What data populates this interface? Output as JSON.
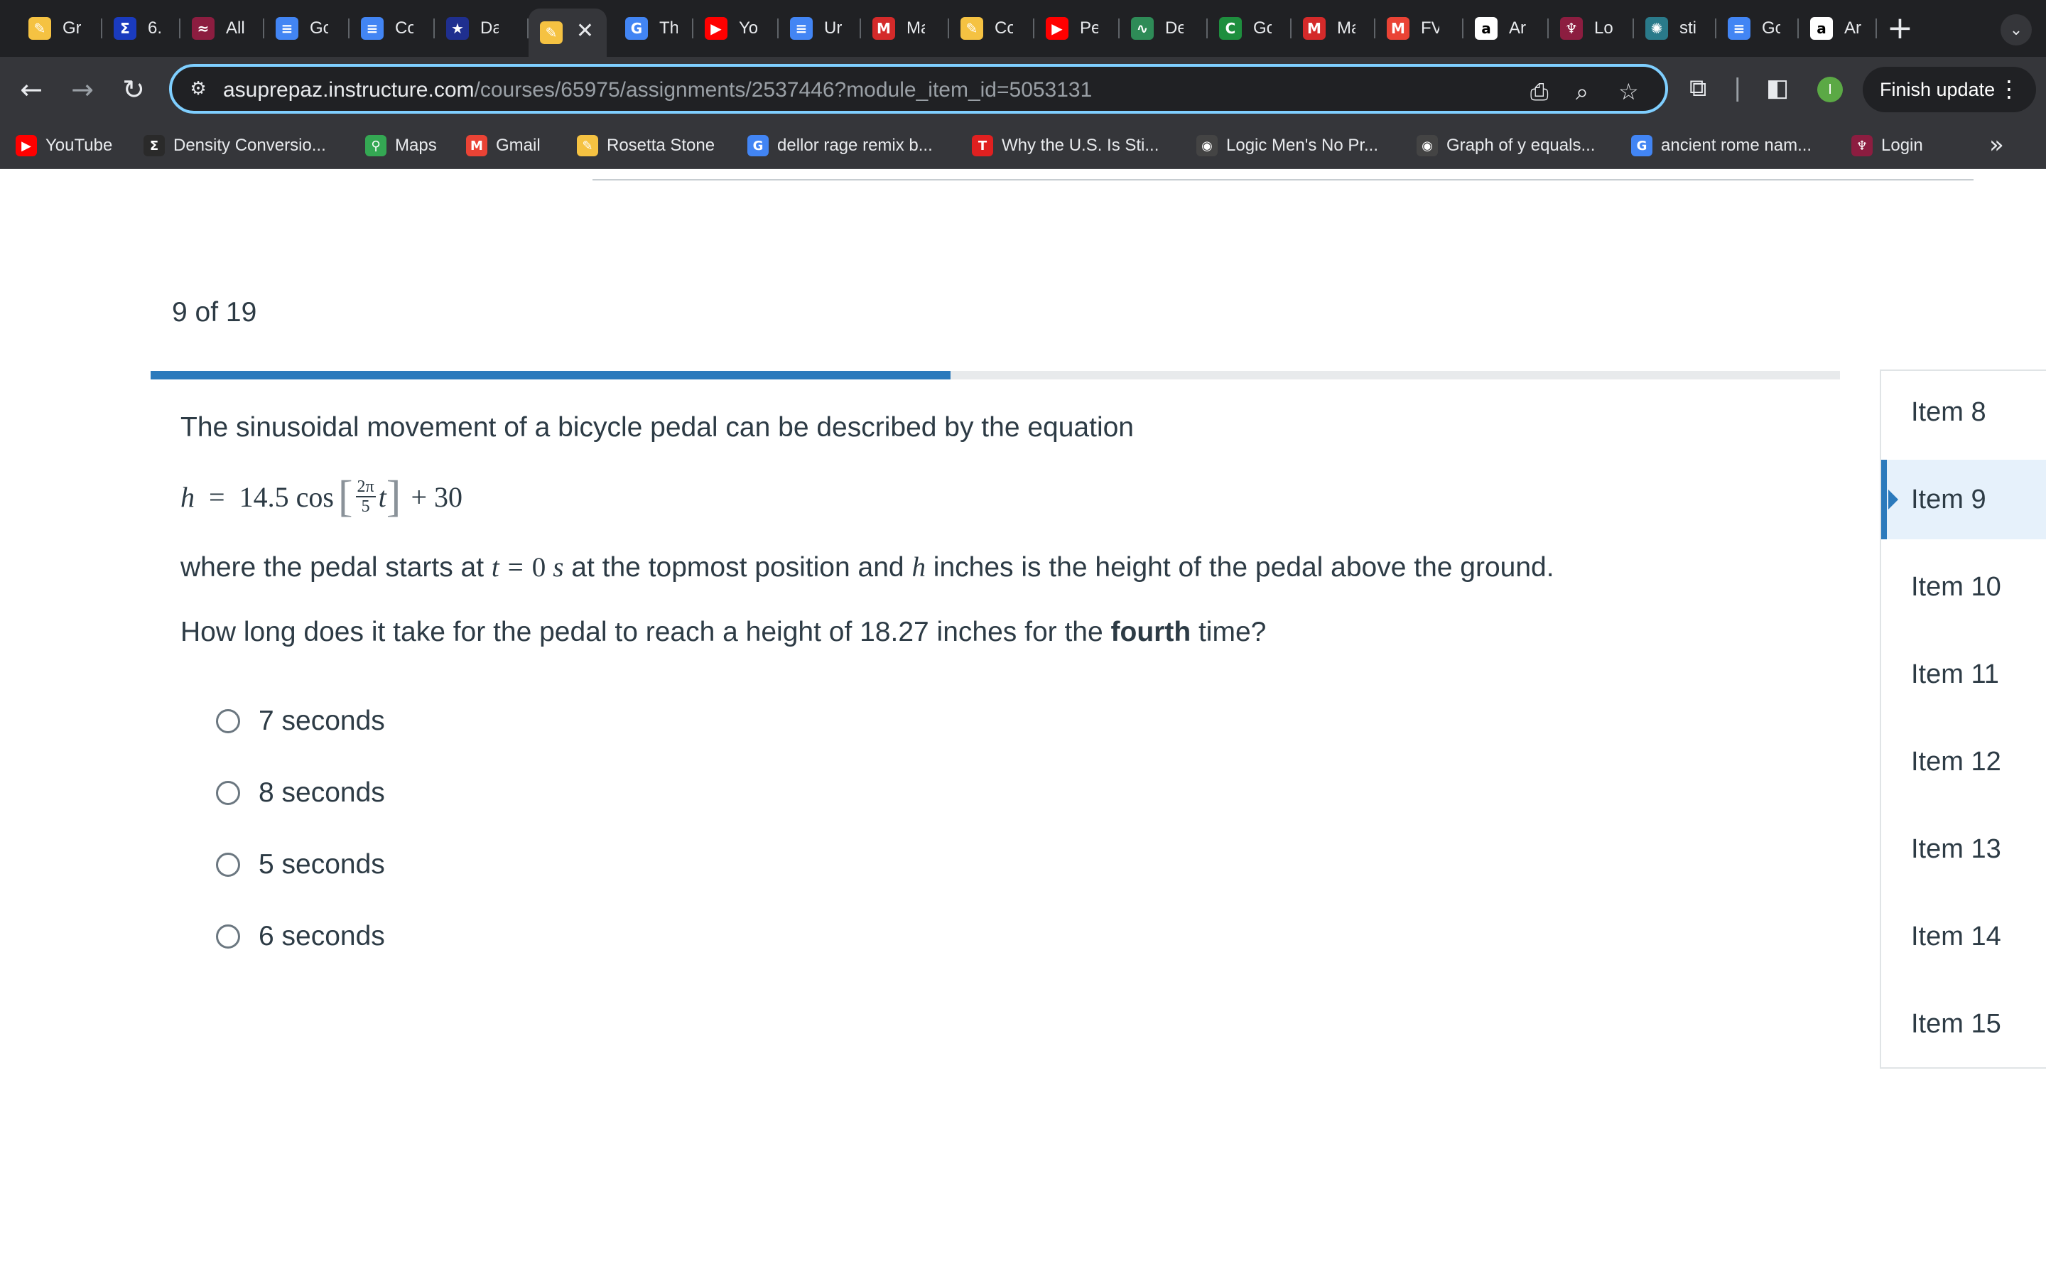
{
  "browser": {
    "tabs": [
      {
        "label": "Gr",
        "icon": "pencil-logo-icon",
        "color": "#f5c242",
        "glyph": "✎"
      },
      {
        "label": "6.",
        "icon": "sigma-icon",
        "color": "#1a3bbf",
        "glyph": "Σ"
      },
      {
        "label": "All",
        "icon": "asu-logo-icon",
        "color": "#8c1d40",
        "glyph": "≈"
      },
      {
        "label": "Go",
        "icon": "docs-icon",
        "color": "#4285f4",
        "glyph": "≡"
      },
      {
        "label": "Co",
        "icon": "docs-icon",
        "color": "#4285f4",
        "glyph": "≡"
      },
      {
        "label": "Da",
        "icon": "star-icon",
        "color": "#1f2f8f",
        "glyph": "★"
      },
      {
        "label": "",
        "icon": "pencil-logo-icon",
        "color": "#f5c242",
        "glyph": "✎",
        "active": true
      },
      {
        "label": "Th",
        "icon": "google-icon",
        "color": "#4285f4",
        "glyph": "G"
      },
      {
        "label": "Yo",
        "icon": "youtube-icon",
        "color": "#ff0000",
        "glyph": "▶"
      },
      {
        "label": "Ur",
        "icon": "docs-icon",
        "color": "#4285f4",
        "glyph": "≡"
      },
      {
        "label": "Ma",
        "icon": "m-logo-icon",
        "color": "#d42a2a",
        "glyph": "M"
      },
      {
        "label": "Co",
        "icon": "pencil-logo-icon",
        "color": "#f5c242",
        "glyph": "✎"
      },
      {
        "label": "Pe",
        "icon": "youtube-icon",
        "color": "#ff0000",
        "glyph": "▶"
      },
      {
        "label": "De",
        "icon": "desmos-icon",
        "color": "#2e8b57",
        "glyph": "∿"
      },
      {
        "label": "Go",
        "icon": "refresh-logo-icon",
        "color": "#1e8e3e",
        "glyph": "C"
      },
      {
        "label": "Ma",
        "icon": "m-logo-icon",
        "color": "#d42a2a",
        "glyph": "M"
      },
      {
        "label": "FV",
        "icon": "gmail-icon",
        "color": "#ea4335",
        "glyph": "M"
      },
      {
        "label": "Ar",
        "icon": "amazon-icon",
        "color": "#ffffff",
        "glyph": "a"
      },
      {
        "label": "Lo",
        "icon": "asu-torch-icon",
        "color": "#8c1d40",
        "glyph": "♆"
      },
      {
        "label": "sti",
        "icon": "globe-icon",
        "color": "#2a7a8a",
        "glyph": "✺"
      },
      {
        "label": "Go",
        "icon": "docs-icon",
        "color": "#4285f4",
        "glyph": "≡"
      },
      {
        "label": "Ar",
        "icon": "amazon-icon",
        "color": "#ffffff",
        "glyph": "a"
      }
    ],
    "url_host": "asuprepaz.instructure.com",
    "url_path": "/courses/65975/assignments/2537446?module_item_id=5053131",
    "finish_update_label": "Finish update",
    "profile_initial": "I",
    "bookmarks": [
      {
        "label": "YouTube",
        "icon": "youtube-icon",
        "color": "#ff0000",
        "glyph": "▶"
      },
      {
        "label": "Density Conversio...",
        "icon": "sigma-icon",
        "color": "#2a2a2a",
        "glyph": "Σ"
      },
      {
        "label": "Maps",
        "icon": "maps-pin-icon",
        "color": "#34a853",
        "glyph": "⚲"
      },
      {
        "label": "Gmail",
        "icon": "gmail-icon",
        "color": "#ea4335",
        "glyph": "M"
      },
      {
        "label": "Rosetta Stone",
        "icon": "pencil-logo-icon",
        "color": "#f5c242",
        "glyph": "✎"
      },
      {
        "label": "dellor rage remix b...",
        "icon": "google-icon",
        "color": "#4285f4",
        "glyph": "G"
      },
      {
        "label": "Why the U.S. Is Sti...",
        "icon": "t-logo-icon",
        "color": "#e02020",
        "glyph": "T"
      },
      {
        "label": "Logic Men's No Pr...",
        "icon": "globe-icon",
        "color": "#444444",
        "glyph": "◉"
      },
      {
        "label": "Graph of y equals...",
        "icon": "globe-icon",
        "color": "#444444",
        "glyph": "◉"
      },
      {
        "label": "ancient rome nam...",
        "icon": "google-icon",
        "color": "#4285f4",
        "glyph": "G"
      },
      {
        "label": "Login",
        "icon": "asu-torch-icon",
        "color": "#8c1d40",
        "glyph": "♆"
      }
    ]
  },
  "quiz": {
    "counter": "9 of 19",
    "progress_fraction": 0.4737,
    "prompt": "The sinusoidal movement of a bicycle pedal can be described by the equation",
    "equation": {
      "lhs": "h",
      "equals": "=",
      "coef": "14.5",
      "func": "cos",
      "frac_num": "2π",
      "frac_den": "5",
      "var": "t",
      "tail": "+ 30"
    },
    "condition": {
      "part1": "where the pedal starts at ",
      "t": "t",
      "eq": "=",
      "zero": "0",
      "s": "s",
      "part2": " at the topmost position and ",
      "h": "h",
      "part3": " inches is the height of the pedal above the ground."
    },
    "ask": {
      "before": "How long does it take for the pedal to reach a height of 18.27 inches for the ",
      "bold": "fourth",
      "after": " time?"
    },
    "choices": [
      "7 seconds",
      "8 seconds",
      "5 seconds",
      "6 seconds"
    ]
  },
  "item_nav": {
    "items": [
      "Item 8",
      "Item 9",
      "Item 10",
      "Item 11",
      "Item 12",
      "Item 13",
      "Item 14",
      "Item 15"
    ],
    "current": "Item 9",
    "accent_color": "#2b7abc"
  }
}
